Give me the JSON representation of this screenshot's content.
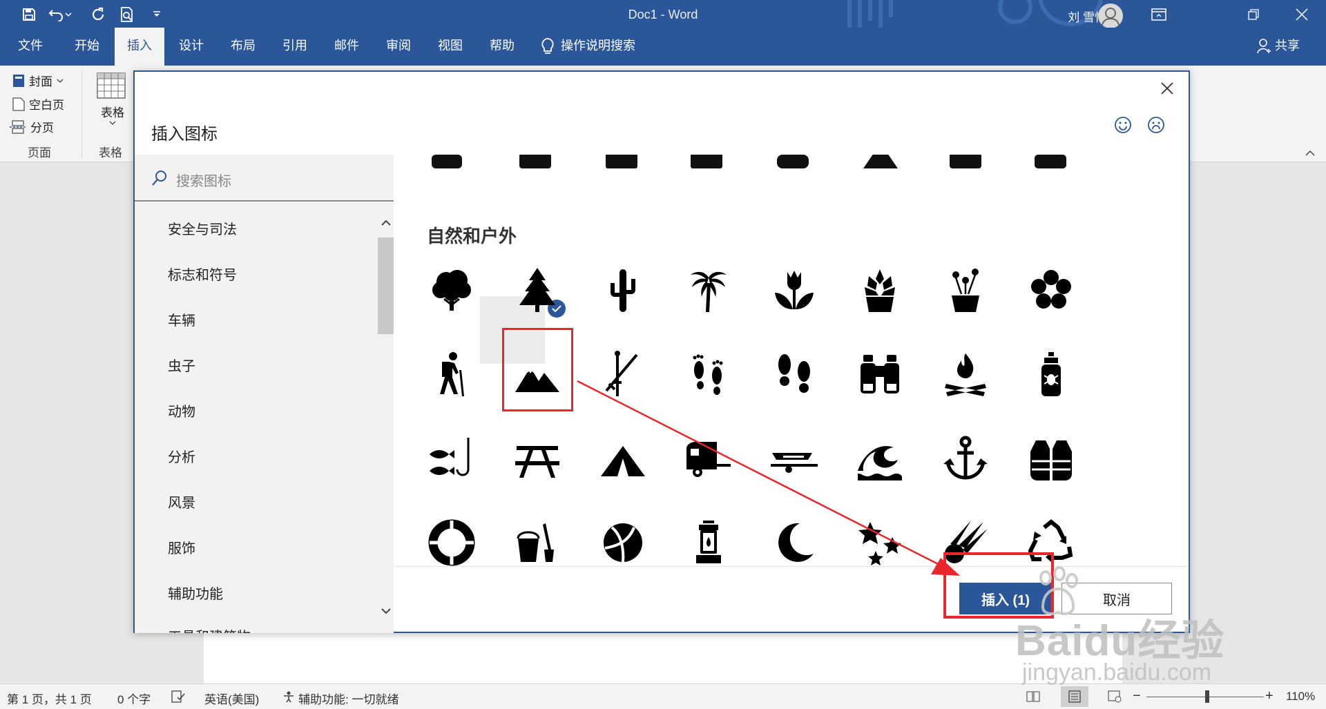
{
  "window": {
    "doc_title": "Doc1  -  Word",
    "user_name": "刘 雪怡"
  },
  "tabs": [
    {
      "label": "文件"
    },
    {
      "label": "开始"
    },
    {
      "label": "插入"
    },
    {
      "label": "设计"
    },
    {
      "label": "布局"
    },
    {
      "label": "引用"
    },
    {
      "label": "邮件"
    },
    {
      "label": "审阅"
    },
    {
      "label": "视图"
    },
    {
      "label": "帮助"
    }
  ],
  "tell_me": "操作说明搜索",
  "share": "共享",
  "ribbon": {
    "pages_items": [
      "封面",
      "空白页",
      "分页"
    ],
    "table_label": "表格",
    "group_pages": "页面",
    "group_table": "表格"
  },
  "dialog": {
    "title": "插入图标",
    "search_placeholder": "搜索图标",
    "categories": [
      "安全与司法",
      "标志和符号",
      "车辆",
      "虫子",
      "动物",
      "分析",
      "风景",
      "服饰",
      "辅助功能",
      "工具和建筑物"
    ],
    "section_title": "自然和户外",
    "insert_label": "插入 (1)",
    "cancel_label": "取消",
    "selected_icon": "mountain-icon",
    "icon_rows": [
      [
        "tree-icon",
        "pine-tree-icon",
        "cactus-icon",
        "palm-tree-icon",
        "tulip-icon",
        "succulent-icon",
        "flower-pot-icon",
        "flower-icon"
      ],
      [
        "hiker-icon",
        "mountain-icon",
        "hiking-poles-icon",
        "footprints-icon",
        "shoe-prints-icon",
        "binoculars-icon",
        "campfire-icon",
        "bug-spray-icon"
      ],
      [
        "fishing-icon",
        "picnic-table-icon",
        "tent-icon",
        "camper-icon",
        "boat-trailer-icon",
        "wave-icon",
        "anchor-icon",
        "life-vest-icon"
      ],
      [
        "life-ring-icon",
        "sand-bucket-icon",
        "beach-ball-icon",
        "lantern-icon",
        "moon-icon",
        "stars-icon",
        "comet-icon",
        "recycle-icon"
      ]
    ]
  },
  "statusbar": {
    "page_info": "第 1 页，共 1 页",
    "word_count": "0 个字",
    "language": "英语(美国)",
    "accessibility": "辅助功能: 一切就绪",
    "zoom": "110%"
  },
  "watermark": {
    "brand": "Baidu经验",
    "url": "jingyan.baidu.com"
  },
  "colors": {
    "word_blue": "#2b579a",
    "annotation_red": "#e8262c"
  }
}
